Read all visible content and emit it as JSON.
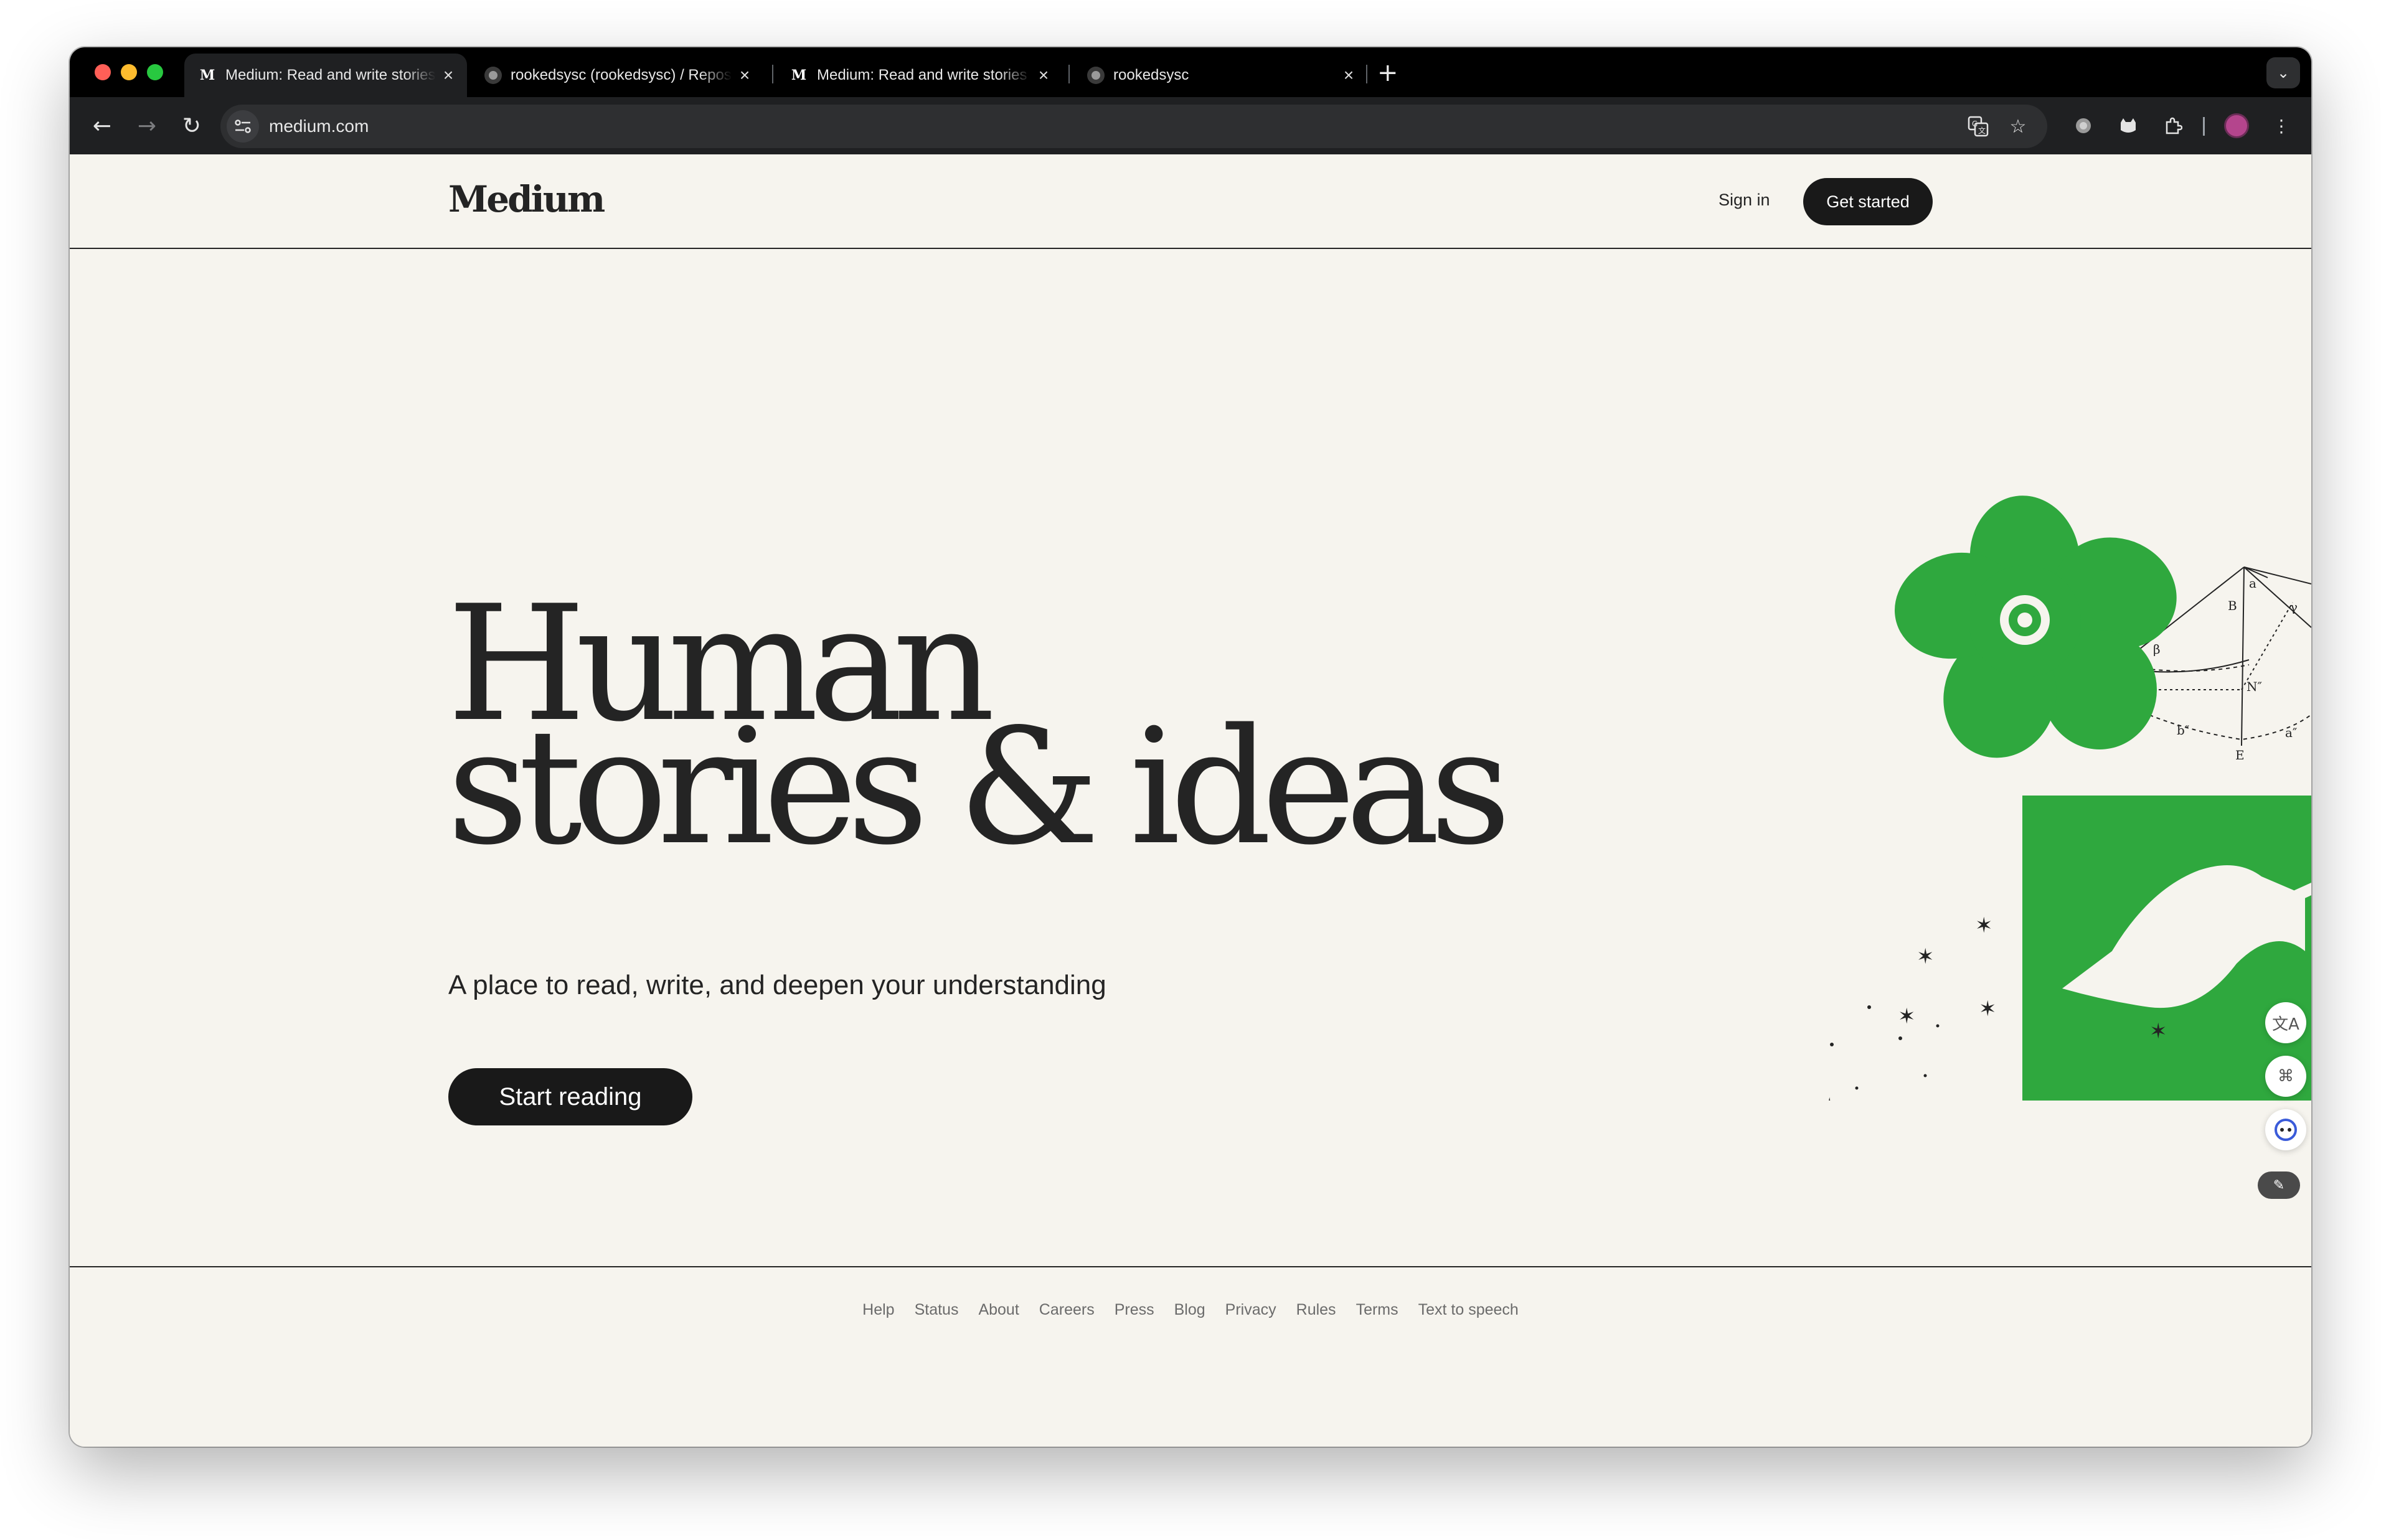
{
  "browser": {
    "tabs": [
      {
        "title": "Medium: Read and write stories",
        "favicon": "M"
      },
      {
        "title": "rookedsysc (rookedsysc) / Repositories",
        "favicon": "github-icon"
      },
      {
        "title": "Medium: Read and write stories",
        "favicon": "M"
      },
      {
        "title": "rookedsysc",
        "favicon": "github-icon"
      }
    ],
    "url": "medium.com"
  },
  "header": {
    "logo": "Medium",
    "sign_in": "Sign in",
    "get_started": "Get started"
  },
  "hero": {
    "title_line1": "Human",
    "title_line2": "stories & ideas",
    "subtitle": "A place to read, write, and deepen your understanding",
    "cta": "Start reading"
  },
  "footer": {
    "links": [
      "Help",
      "Status",
      "About",
      "Careers",
      "Press",
      "Blog",
      "Privacy",
      "Rules",
      "Terms",
      "Text to speech"
    ]
  },
  "colors": {
    "accent_green": "#2fa83e",
    "text_dark": "#242424",
    "page_bg": "#f6f4ee",
    "button_bg": "#191919"
  }
}
